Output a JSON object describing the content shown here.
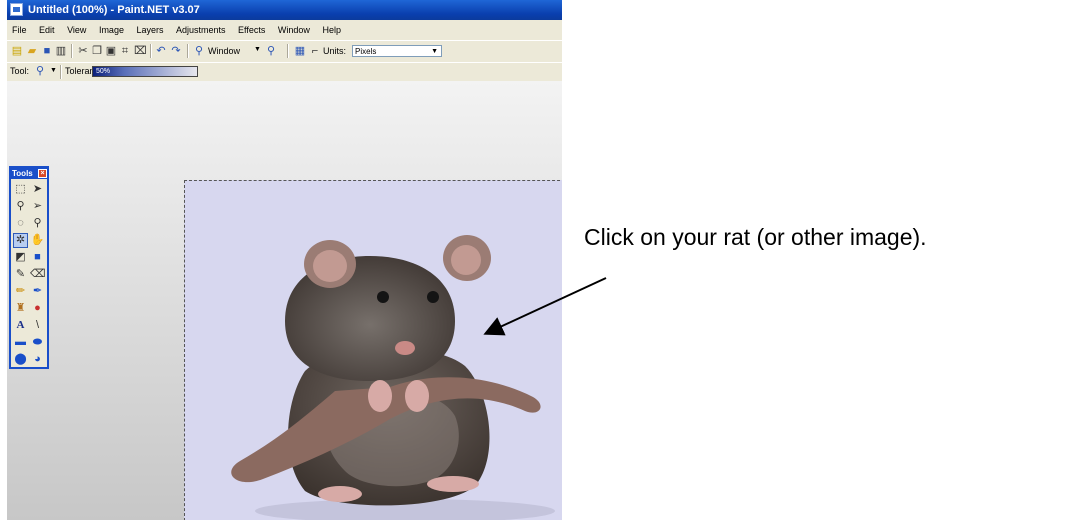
{
  "titlebar": {
    "title": "Untitled (100%) - Paint.NET v3.07"
  },
  "menu": [
    "File",
    "Edit",
    "View",
    "Image",
    "Layers",
    "Adjustments",
    "Effects",
    "Window",
    "Help"
  ],
  "toolbar": {
    "zoom_value": "Window",
    "units_label": "Units:",
    "units_value": "Pixels",
    "tool_label": "Tool:",
    "tolerance_label": "Tolerance:",
    "tolerance_value": "50%",
    "tolerance_fraction": 0.5
  },
  "tools_panel": {
    "title": "Tools",
    "close": "×"
  },
  "annotation": {
    "text": "Click on your rat (or other image)."
  },
  "colors": {
    "titlebar": "#0a3fae",
    "canvas_background": "#d7d7ef",
    "tools_border": "#1a4fc9"
  }
}
